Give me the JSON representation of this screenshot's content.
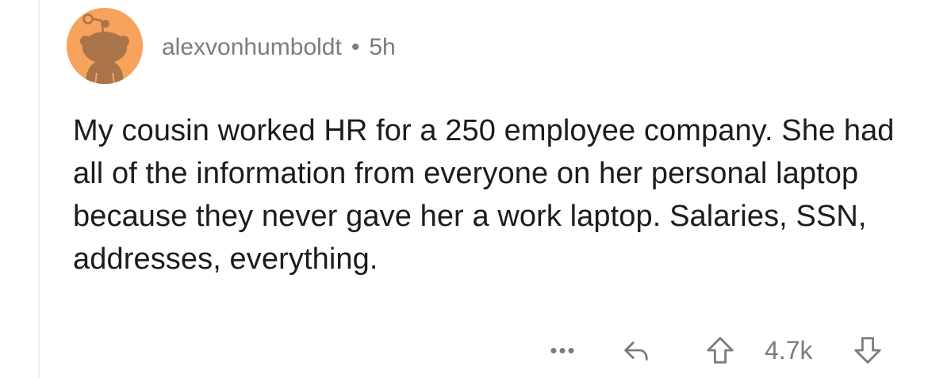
{
  "comment": {
    "author": "alexvonhumboldt",
    "separator": "•",
    "time_ago": "5h",
    "body": "My cousin worked HR for a 250 employee company. She had all of the information from everyone on her personal laptop because they never gave her a work laptop. Salaries, SSN, addresses, everything.",
    "avatar_icon": "snoo-avatar-icon",
    "avatar_color": "#f7a35c"
  },
  "actions": {
    "more_label": "•••",
    "reply_icon": "reply-icon",
    "upvote_icon": "upvote-arrow-icon",
    "score": "4.7k",
    "downvote_icon": "downvote-arrow-icon"
  }
}
